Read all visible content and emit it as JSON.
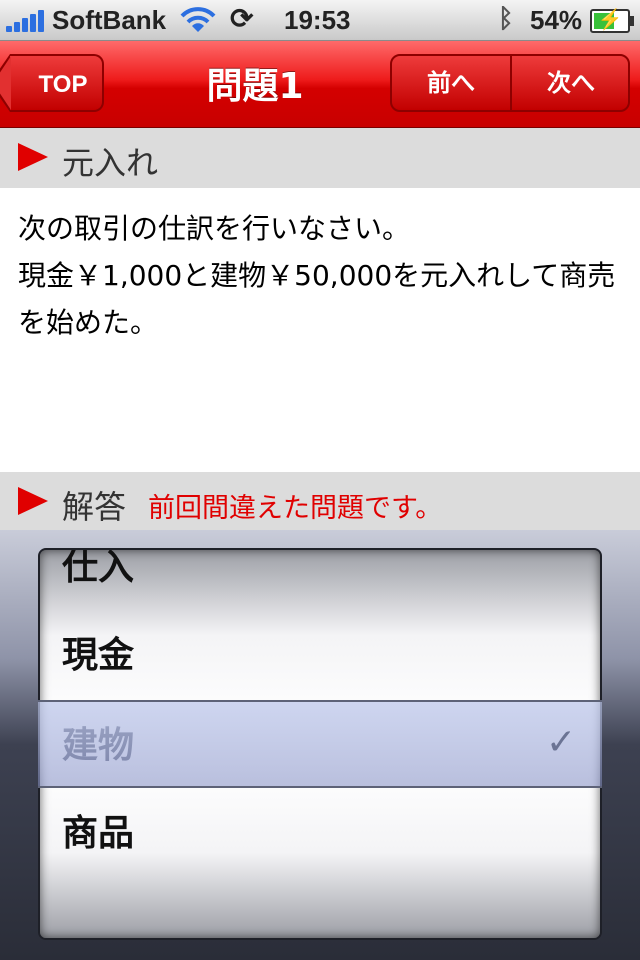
{
  "status_bar": {
    "carrier": "SoftBank",
    "time": "19:53",
    "battery_percent": "54%",
    "icons": [
      "signal-icon",
      "wifi-icon",
      "sync-icon",
      "bluetooth-icon",
      "battery-charging-icon"
    ]
  },
  "nav": {
    "back_label": "TOP",
    "title": "問題1",
    "prev_label": "前へ",
    "next_label": "次へ",
    "color": "#e00000"
  },
  "section_motoire": {
    "label": "元入れ"
  },
  "question": {
    "line1": "次の取引の仕訳を行いなさい。",
    "line2": "現金￥1,000と建物￥50,000を元入れして商売を始めた。"
  },
  "section_answer": {
    "label": "解答",
    "note": "前回間違えた問題です。"
  },
  "picker": {
    "items": [
      "仕入",
      "現金",
      "建物",
      "商品"
    ],
    "selected": "建物",
    "check_mark": "✓"
  }
}
